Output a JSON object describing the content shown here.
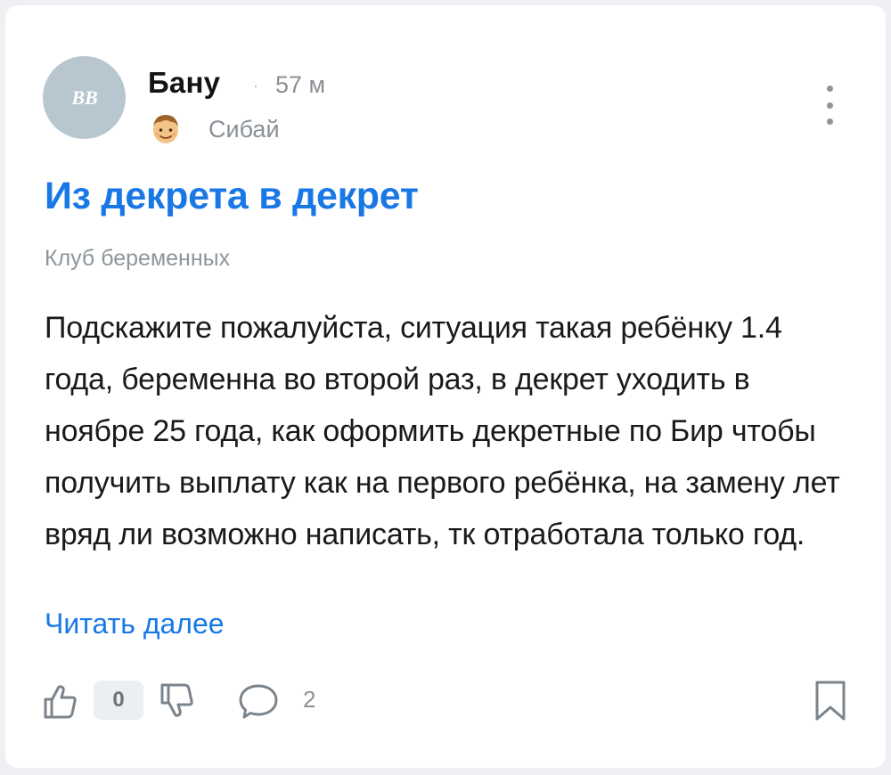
{
  "post": {
    "author": {
      "initials": "BB",
      "name": "Бану",
      "time_separator": "·",
      "time_ago": "57 м",
      "city_icon": "person-emoji-icon",
      "city": "Сибай"
    },
    "title": "Из декрета в декрет",
    "club": "Клуб беременных",
    "body": "Подскажите пожалуйста, ситуация такая ребёнку 1.4 года, беременна во второй раз, в декрет уходить в ноябре 25 года, как оформить декретные по Бир чтобы получить выплату как на первого ребёнка, на замену лет вряд ли возможно написать, тк отработала только год.",
    "read_more": "Читать далее",
    "actions": {
      "like_icon": "thumbs-up-icon",
      "like_count": "0",
      "dislike_icon": "thumbs-down-icon",
      "comment_icon": "comment-bubble-icon",
      "comment_count": "2",
      "bookmark_icon": "bookmark-icon"
    }
  },
  "colors": {
    "accent": "#1a78e6",
    "avatar_bg": "#b8c6cf",
    "muted_text": "#8a9096",
    "page_bg": "#eef0f3"
  }
}
